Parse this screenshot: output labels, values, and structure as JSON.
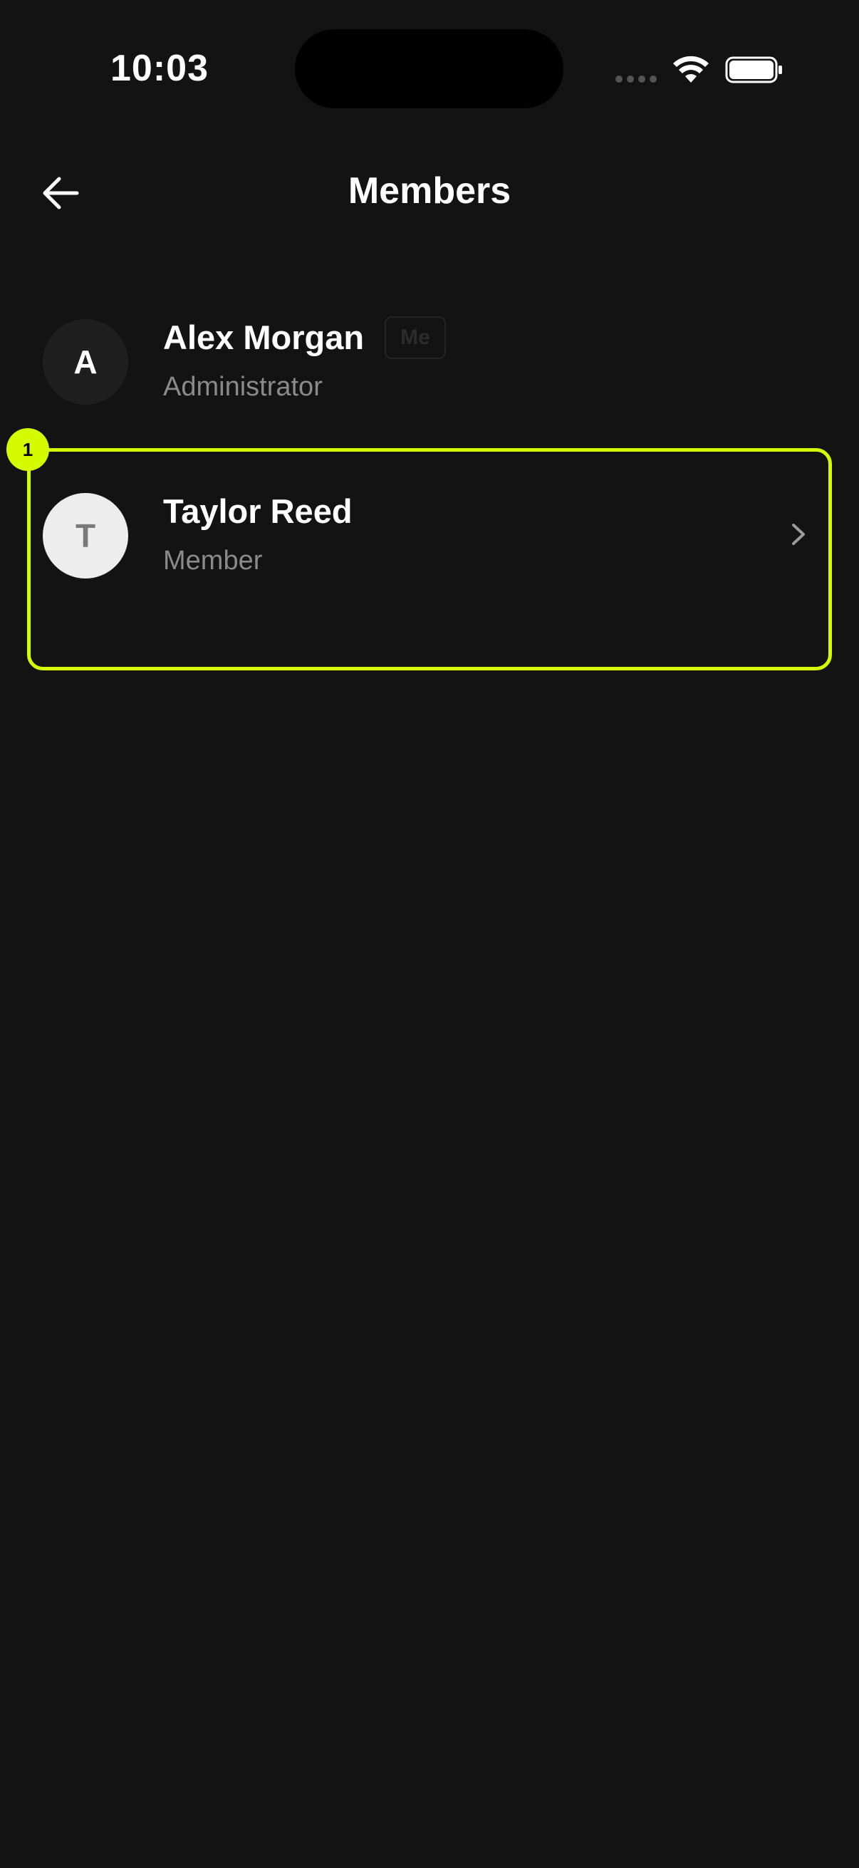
{
  "status_bar": {
    "time": "10:03"
  },
  "header": {
    "title": "Members",
    "back_icon": "arrow-left-icon"
  },
  "members": [
    {
      "initial": "A",
      "name": "Alex Morgan",
      "role": "Administrator",
      "badge": "Me"
    },
    {
      "initial": "T",
      "name": "Taylor Reed",
      "role": "Member"
    }
  ],
  "annotation": {
    "marker": "1",
    "color": "#d4fb00"
  },
  "colors": {
    "background": "#131313",
    "text_primary": "#ffffff",
    "text_secondary": "#8a8a8a",
    "highlight": "#d4fb00"
  }
}
